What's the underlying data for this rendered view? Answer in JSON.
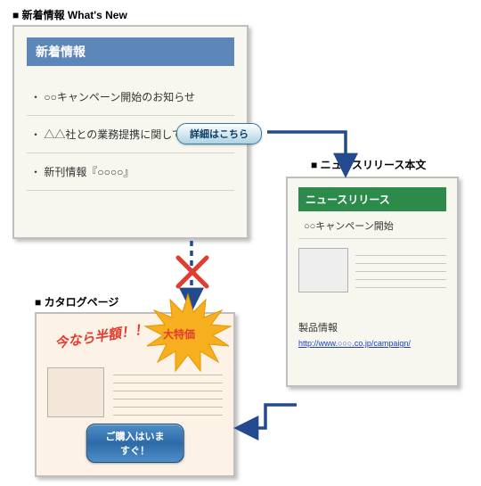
{
  "labels": {
    "whatsnew_section": "■ 新着情報  What's New",
    "release_section": "■ ニュースリリース本文",
    "catalog_section": "■ カタログページ"
  },
  "whatsnew": {
    "header": "新着情報",
    "items": [
      "・ ○○キャンペーン開始のお知らせ",
      "・ △△社との業務提携に関して",
      "・ 新刊情報『○○○○』"
    ],
    "detail_btn": "詳細はこちら"
  },
  "release": {
    "header": "ニュースリリース",
    "title": "○○キャンペーン開始",
    "product_label": "製品情報",
    "product_url": "http://www.○○○.co.jp/campaign/"
  },
  "catalog": {
    "halfprice": "今なら半額！！",
    "star_text": "大特価",
    "buy_btn": "ご購入はいますぐ！"
  },
  "colors": {
    "whatsnew_header": "#5d86b9",
    "release_header": "#2c8b4a",
    "accent_red": "#e43b2f",
    "star_fill": "#f6b01f",
    "arrow": "#234a8c"
  }
}
